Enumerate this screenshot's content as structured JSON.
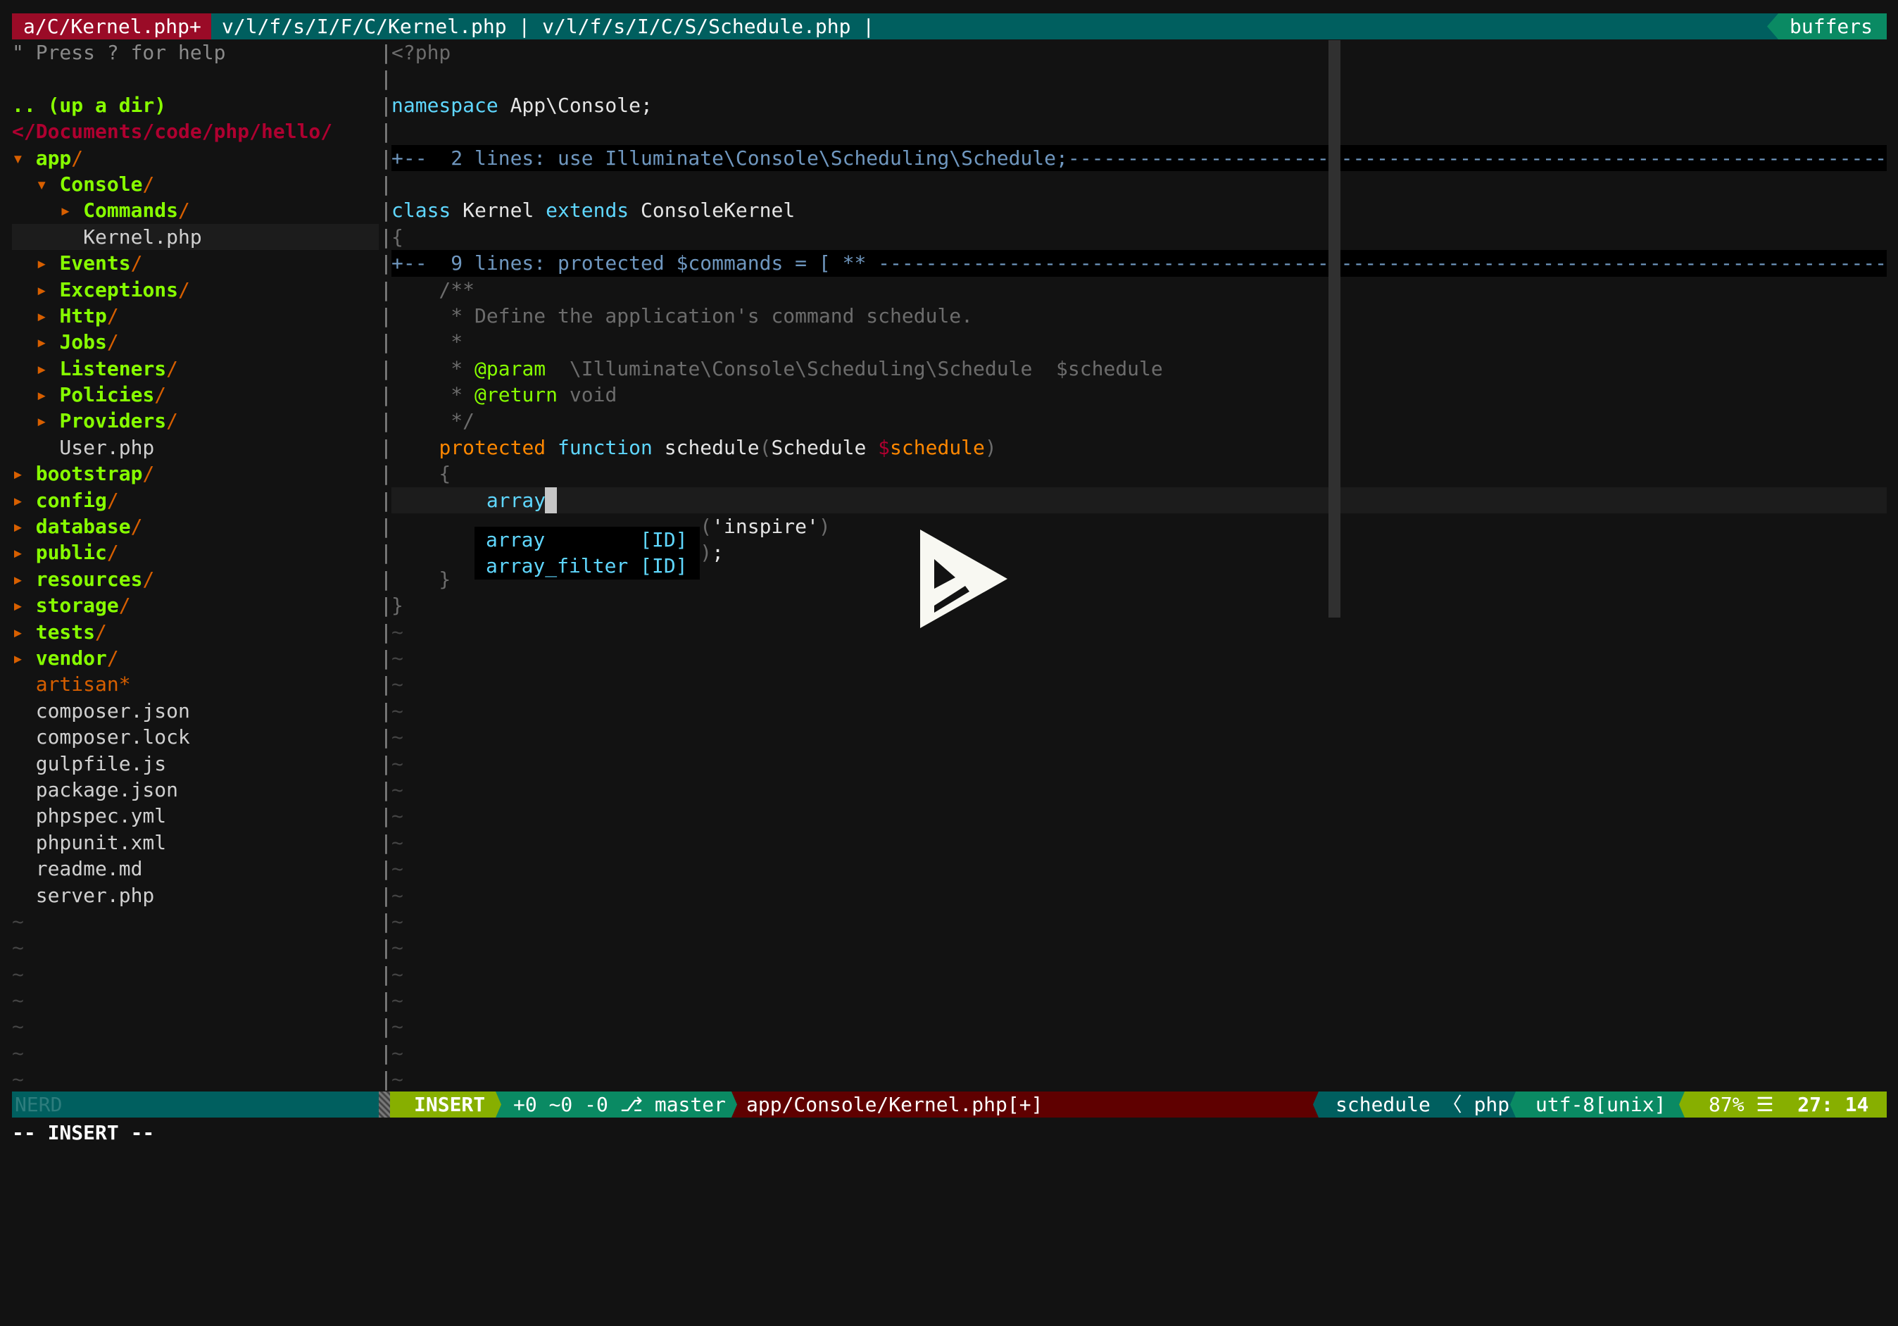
{
  "tabline": {
    "active_tab": "a/C/Kernel.php+",
    "other_tabs": "v/l/f/s/I/F/C/Kernel.php | v/l/f/s/I/C/S/Schedule.php |",
    "buffers_label": "buffers"
  },
  "tree": {
    "help": "\" Press ? for help",
    "up_dir": ".. (up a dir)",
    "root_path": "</Documents/code/php/hello/",
    "items": [
      {
        "depth": 0,
        "type": "dir",
        "name": "app",
        "open": true
      },
      {
        "depth": 1,
        "type": "dir",
        "name": "Console",
        "open": true
      },
      {
        "depth": 2,
        "type": "dir",
        "name": "Commands",
        "open": false
      },
      {
        "depth": 2,
        "type": "file",
        "name": "Kernel.php",
        "selected": true
      },
      {
        "depth": 1,
        "type": "dir",
        "name": "Events",
        "open": false
      },
      {
        "depth": 1,
        "type": "dir",
        "name": "Exceptions",
        "open": false
      },
      {
        "depth": 1,
        "type": "dir",
        "name": "Http",
        "open": false
      },
      {
        "depth": 1,
        "type": "dir",
        "name": "Jobs",
        "open": false
      },
      {
        "depth": 1,
        "type": "dir",
        "name": "Listeners",
        "open": false
      },
      {
        "depth": 1,
        "type": "dir",
        "name": "Policies",
        "open": false
      },
      {
        "depth": 1,
        "type": "dir",
        "name": "Providers",
        "open": false
      },
      {
        "depth": 1,
        "type": "file",
        "name": "User.php"
      },
      {
        "depth": 0,
        "type": "dir",
        "name": "bootstrap",
        "open": false
      },
      {
        "depth": 0,
        "type": "dir",
        "name": "config",
        "open": false
      },
      {
        "depth": 0,
        "type": "dir",
        "name": "database",
        "open": false
      },
      {
        "depth": 0,
        "type": "dir",
        "name": "public",
        "open": false
      },
      {
        "depth": 0,
        "type": "dir",
        "name": "resources",
        "open": false
      },
      {
        "depth": 0,
        "type": "dir",
        "name": "storage",
        "open": false
      },
      {
        "depth": 0,
        "type": "dir",
        "name": "tests",
        "open": false
      },
      {
        "depth": 0,
        "type": "dir",
        "name": "vendor",
        "open": false
      },
      {
        "depth": 0,
        "type": "exec",
        "name": "artisan*"
      },
      {
        "depth": 0,
        "type": "file",
        "name": "composer.json"
      },
      {
        "depth": 0,
        "type": "file",
        "name": "composer.lock"
      },
      {
        "depth": 0,
        "type": "file",
        "name": "gulpfile.js"
      },
      {
        "depth": 0,
        "type": "file",
        "name": "package.json"
      },
      {
        "depth": 0,
        "type": "file",
        "name": "phpspec.yml"
      },
      {
        "depth": 0,
        "type": "file",
        "name": "phpunit.xml"
      },
      {
        "depth": 0,
        "type": "file",
        "name": "readme.md"
      },
      {
        "depth": 0,
        "type": "file",
        "name": "server.php"
      }
    ],
    "empty_marker": "~"
  },
  "editor": {
    "lines": [
      [
        [
          "<?php",
          "dim"
        ]
      ],
      [],
      [
        [
          "namespace",
          "kw"
        ],
        [
          " App\\Console;",
          "plain"
        ]
      ],
      [],
      {
        "fold": "+--  2 lines: use Illuminate\\Console\\Scheduling\\Schedule;"
      },
      [],
      [
        [
          "class",
          "kw"
        ],
        [
          " Kernel ",
          "plain"
        ],
        [
          "extends",
          "kw"
        ],
        [
          " ConsoleKernel",
          "plain"
        ]
      ],
      [
        [
          "{",
          "dim"
        ]
      ],
      {
        "fold": "+--  9 lines: protected $commands = [ ** "
      },
      [
        [
          "    /**",
          "comment"
        ]
      ],
      [
        [
          "     * Define the application's command schedule.",
          "comment"
        ]
      ],
      [
        [
          "     *",
          "comment"
        ]
      ],
      [
        [
          "     * ",
          "comment"
        ],
        [
          "@param",
          "tag"
        ],
        [
          "  \\Illuminate\\Console\\Scheduling\\Schedule  $schedule",
          "comment"
        ]
      ],
      [
        [
          "     * ",
          "comment"
        ],
        [
          "@return",
          "tag"
        ],
        [
          " void",
          "comment"
        ]
      ],
      [
        [
          "     */",
          "comment"
        ]
      ],
      [
        [
          "    ",
          "plain"
        ],
        [
          "protected",
          "mod"
        ],
        [
          " ",
          "plain"
        ],
        [
          "function",
          "kw"
        ],
        [
          " schedule",
          "plain"
        ],
        [
          "(",
          "dim"
        ],
        [
          "Schedule ",
          "plain"
        ],
        [
          "$",
          "dollar"
        ],
        [
          "schedule",
          "var"
        ],
        [
          ")",
          "dim"
        ]
      ],
      [
        [
          "    {",
          "dim"
        ]
      ],
      {
        "cursor": true,
        "tokens": [
          [
            "        ",
            "plain"
          ],
          [
            "array",
            "kw"
          ]
        ]
      },
      [
        [
          "                          ",
          "plain"
        ],
        [
          "(",
          "dim"
        ],
        [
          "'inspire'",
          "plain"
        ],
        [
          ")",
          "dim"
        ]
      ],
      [
        [
          "                          ",
          "plain"
        ],
        [
          ")",
          "dim"
        ],
        [
          ";",
          "plain"
        ]
      ],
      [
        [
          "    }",
          "dim"
        ]
      ],
      [
        [
          "}",
          "dim"
        ]
      ]
    ],
    "empty_marker": "~",
    "total_rows": 40,
    "separator": "|"
  },
  "completion_popup": {
    "items": [
      {
        "word": "array       ",
        "kind": "[ID]"
      },
      {
        "word": "array_filter",
        "kind": "[ID]"
      }
    ]
  },
  "statusline": {
    "nerd": "NERD",
    "mode": "INSERT",
    "git": "+0 ~0 -0 ⎇ master",
    "file": "app/Console/Kernel.php[+]",
    "function": "schedule",
    "filetype": "php",
    "encoding": "utf-8[unix]",
    "percent": "87% ☰",
    "position": "27: 14"
  },
  "cmdline": "-- INSERT --",
  "colors": {
    "accent_red": "#9a0b27",
    "teal": "#005f5f",
    "green": "#0a8a63",
    "lime": "#87af00",
    "dark_red": "#5f0000"
  }
}
